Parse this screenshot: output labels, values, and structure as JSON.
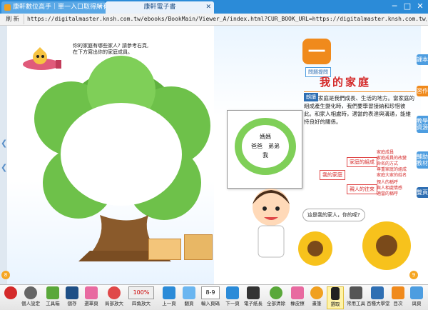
{
  "browser": {
    "tabs": [
      {
        "label": "康軒數位高手｜單一入口取得所有資源"
      },
      {
        "label": "康軒電子書"
      }
    ],
    "window_controls": {
      "minimize": "─",
      "maximize": "□",
      "close": "✕"
    },
    "refresh_label": "刷 新",
    "url": "https://digitalmaster.knsh.com.tw/ebooks/BookMain/Viewer_A/index.html?CUR_BOOK_URL=https://digitalmaster.knsh.com.tw/ebooks"
  },
  "left_page": {
    "intro": "你的家庭有哪些家人? 請參考右頁,\n在下方寫出你的家庭成員。",
    "page_number": "8"
  },
  "picture_card": {
    "lines": [
      "媽媽",
      "爸爸　弟弟",
      "我"
    ]
  },
  "right_page": {
    "badge": "一",
    "header": "問題提問",
    "title": "我的家庭",
    "section_label": "朗讀",
    "paragraph": "家庭是我們成長、生活的地方。當家庭的組成產生變化時，我們要學習接納和珍惜彼此。和家人相處時，適當的表達與溝通，能維持良好的關係。",
    "mindmap": {
      "root": "我的家庭",
      "branches": [
        {
          "label": "家庭的組成",
          "leaves": [
            "家庭成員",
            "家庭成員的改變",
            "命名的方式",
            "尊重家庭的組成",
            "家庭大家的姓名"
          ]
        },
        {
          "label": "親人的往來",
          "leaves": [
            "親人的稱呼",
            "與人相處情感",
            "適當的稱呼"
          ]
        }
      ]
    },
    "bubble": "這是我的家人，你的呢?",
    "page_number": "9"
  },
  "sidebar_tabs": [
    "課本",
    "習作",
    "教學資源",
    "輔助教材",
    "雙頁"
  ],
  "toolbar": [
    {
      "label": "",
      "icon": "fire-icon"
    },
    {
      "label": "個人設定",
      "icon": "gear-icon"
    },
    {
      "label": "工具箱",
      "icon": "toolbox-icon"
    },
    {
      "label": "儲存",
      "icon": "save-icon"
    },
    {
      "label": "選單頁",
      "icon": "grid-icon"
    },
    {
      "label": "局部放大",
      "icon": "zoom-in-icon"
    },
    {
      "label": "百分比",
      "icon": "percent-icon",
      "value": "100%"
    },
    {
      "label": "四角放大",
      "icon": "expand-icon"
    },
    {
      "label": "上一頁",
      "icon": "prev-page-icon"
    },
    {
      "label": "翻頁",
      "icon": "page-icon"
    },
    {
      "label": "輸入頁碼",
      "icon": "page-input-icon",
      "value": "8-9"
    },
    {
      "label": "下一頁",
      "icon": "next-page-icon"
    },
    {
      "label": "電子紙長",
      "icon": "graduation-icon"
    },
    {
      "label": "全部清除",
      "icon": "clear-all-icon"
    },
    {
      "label": "橡皮擦",
      "icon": "eraser-icon"
    },
    {
      "label": "畫筆",
      "icon": "palette-icon"
    },
    {
      "label": "選取",
      "icon": "cursor-icon"
    },
    {
      "label": "常用工具",
      "icon": "compass-icon"
    },
    {
      "label": "百種大學堂",
      "icon": "book-stack-icon"
    },
    {
      "label": "目次",
      "icon": "contents-icon"
    },
    {
      "label": "與頁",
      "icon": "page-list-icon"
    }
  ],
  "colors": {
    "titlebar": "#2b8bd8",
    "sidebar_tab": "#4d9de0",
    "accent_orange": "#f08a1c",
    "title_red": "#d42a2a",
    "tree_green": "#6ec14a"
  }
}
